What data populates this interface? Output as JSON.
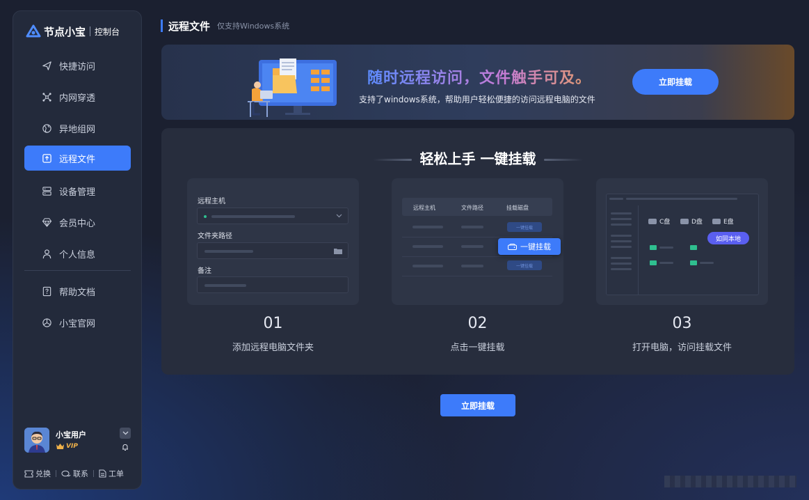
{
  "brand": {
    "name": "节点小宝",
    "console": "控制台"
  },
  "sidebar": {
    "items": [
      {
        "label": "快捷访问",
        "icon": "send-icon"
      },
      {
        "label": "内网穿透",
        "icon": "network-icon"
      },
      {
        "label": "异地组网",
        "icon": "globe-icon"
      },
      {
        "label": "远程文件",
        "icon": "upload-folder-icon",
        "active": true
      },
      {
        "label": "设备管理",
        "icon": "server-icon"
      },
      {
        "label": "会员中心",
        "icon": "diamond-icon"
      },
      {
        "label": "个人信息",
        "icon": "user-icon"
      },
      {
        "label": "帮助文档",
        "icon": "help-icon"
      },
      {
        "label": "小宝官网",
        "icon": "compass-icon"
      }
    ]
  },
  "user": {
    "name": "小宝用户",
    "badge": "VIP"
  },
  "footer": {
    "exchange": "兑换",
    "contact": "联系",
    "ticket": "工单"
  },
  "header": {
    "title": "远程文件",
    "subtitle": "仅支持Windows系统"
  },
  "banner": {
    "headline": "随时远程访问，文件触手可及。",
    "description": "支持了windows系统，帮助用户轻松便捷的访问远程电脑的文件",
    "button": "立即挂载"
  },
  "guide": {
    "title": "轻松上手 一键挂载",
    "steps": [
      {
        "num": "01",
        "desc": "添加远程电脑文件夹"
      },
      {
        "num": "02",
        "desc": "点击一键挂载"
      },
      {
        "num": "03",
        "desc": "打开电脑，访问挂载文件"
      }
    ],
    "card1": {
      "host": "远程主机",
      "path": "文件夹路径",
      "note": "备注"
    },
    "card2": {
      "col_host": "远程主机",
      "col_path": "文件路径",
      "col_mount": "挂载磁盘",
      "action": "一键挂载",
      "action_small": "一键挂载"
    },
    "card3": {
      "drive_c": "C盘",
      "drive_d": "D盘",
      "drive_e": "E盘",
      "bubble": "如同本地"
    }
  },
  "main_button": "立即挂载",
  "colors": {
    "accent": "#3d7bfa",
    "sidebar_bg": "#232a3b",
    "page_bg": "#1b2030"
  }
}
